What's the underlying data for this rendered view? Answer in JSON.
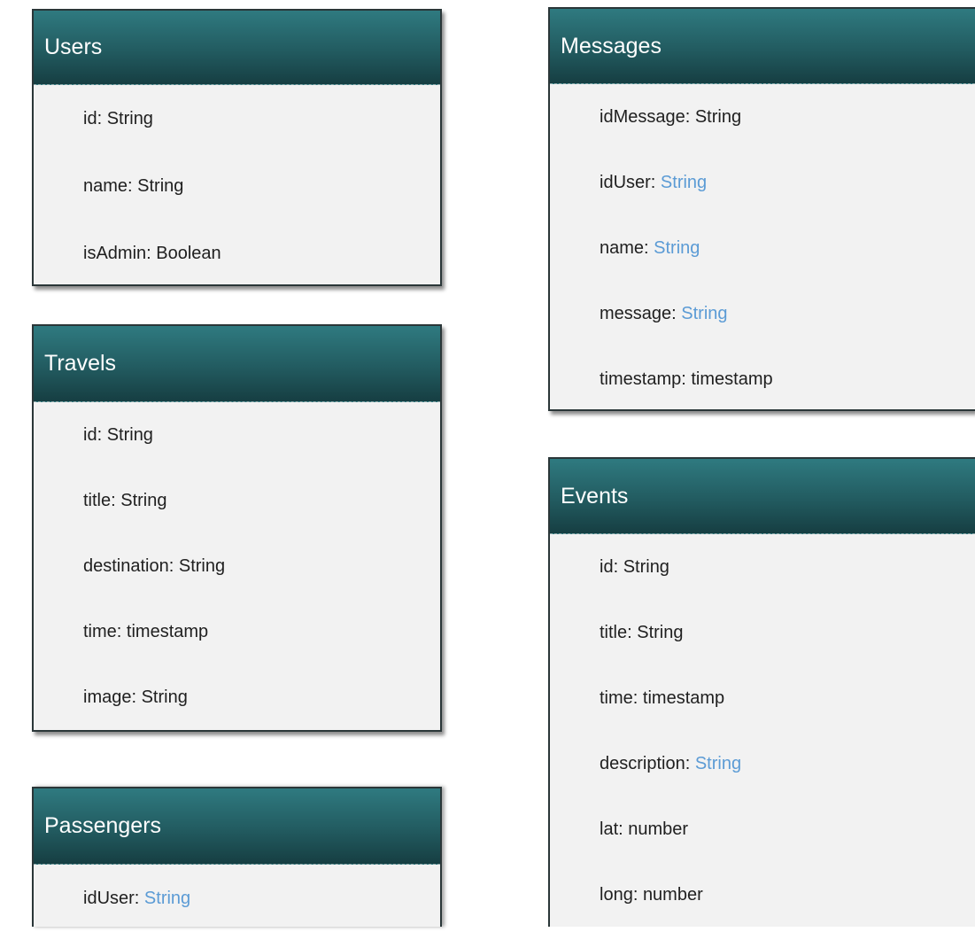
{
  "entities": {
    "users": {
      "title": "Users",
      "fields": [
        {
          "name": "id:",
          "type": "String",
          "link": false
        },
        {
          "name": "name:",
          "type": "String",
          "link": false
        },
        {
          "name": "isAdmin:",
          "type": "Boolean",
          "link": false
        }
      ]
    },
    "travels": {
      "title": "Travels",
      "fields": [
        {
          "name": "id:",
          "type": "String",
          "link": false
        },
        {
          "name": "title:",
          "type": "String",
          "link": false
        },
        {
          "name": "destination:",
          "type": "String",
          "link": false
        },
        {
          "name": "time:",
          "type": "timestamp",
          "link": false
        },
        {
          "name": "image:",
          "type": "String",
          "link": false
        }
      ]
    },
    "passengers": {
      "title": "Passengers",
      "fields": [
        {
          "name": "idUser:",
          "type": "String",
          "link": true
        }
      ]
    },
    "messages": {
      "title": "Messages",
      "fields": [
        {
          "name": "idMessage:",
          "type": "String",
          "link": false
        },
        {
          "name": "idUser:",
          "type": "String",
          "link": true
        },
        {
          "name": "name:",
          "type": "String",
          "link": true
        },
        {
          "name": "message:",
          "type": "String",
          "link": true
        },
        {
          "name": "timestamp:",
          "type": "timestamp",
          "link": false
        }
      ]
    },
    "events": {
      "title": "Events",
      "fields": [
        {
          "name": "id:",
          "type": "String",
          "link": false
        },
        {
          "name": "title:",
          "type": "String",
          "link": false
        },
        {
          "name": "time:",
          "type": "timestamp",
          "link": false
        },
        {
          "name": "description:",
          "type": "String",
          "link": true
        },
        {
          "name": "lat:",
          "type": "number",
          "link": false
        },
        {
          "name": "long:",
          "type": "number",
          "link": false
        }
      ]
    }
  },
  "colors": {
    "header_top": "#2f7a80",
    "header_bottom": "#163e42",
    "body_bg": "#f2f2f2",
    "link_type": "#5b9bd5"
  }
}
